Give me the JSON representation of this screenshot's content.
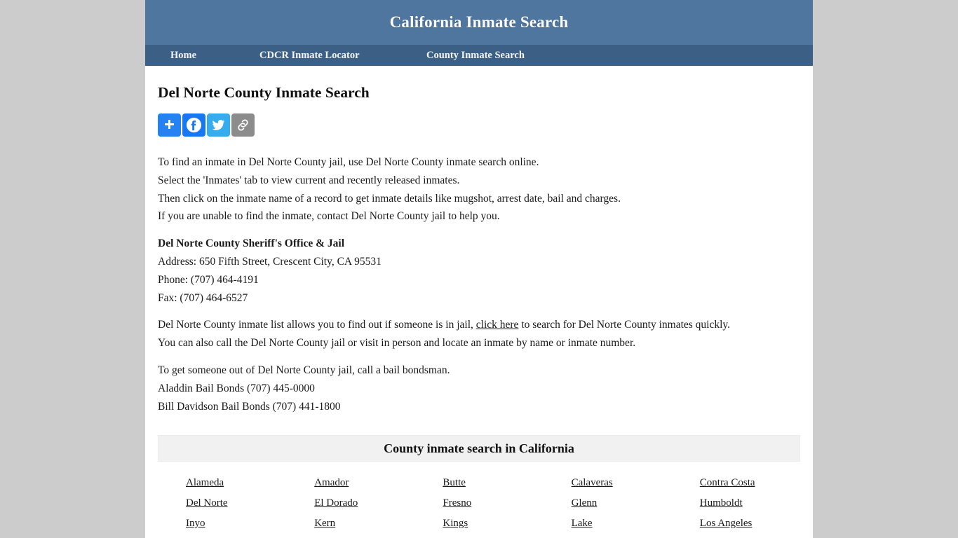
{
  "site": {
    "title": "California Inmate Search",
    "header_bg": "#4f769e",
    "nav_bg": "#3c6085",
    "page_bg": "#cccccc"
  },
  "nav": {
    "items": [
      {
        "label": "Home"
      },
      {
        "label": "CDCR Inmate Locator"
      },
      {
        "label": "County Inmate Search"
      }
    ]
  },
  "main": {
    "page_title": "Del Norte County Inmate Search",
    "share": {
      "buttons": [
        {
          "name": "addthis",
          "label": "Share",
          "color": "#2681f2"
        },
        {
          "name": "facebook",
          "label": "Facebook",
          "color": "#1877f2"
        },
        {
          "name": "twitter",
          "label": "Twitter",
          "color": "#35acee"
        },
        {
          "name": "copy-link",
          "label": "Copy Link",
          "color": "#8c8c8c"
        }
      ]
    },
    "intro_lines": [
      "To find an inmate in Del Norte County jail, use Del Norte County inmate search online.",
      "Select the 'Inmates' tab to view current and recently released inmates.",
      "Then click on the inmate name of a record to get inmate details like mugshot, arrest date, bail and charges.",
      "If you are unable to find the inmate, contact Del Norte County jail to help you."
    ],
    "facility": {
      "name": "Del Norte County Sheriff's Office & Jail",
      "address": "Address: 650 Fifth Street, Crescent City, CA 95531",
      "phone": "Phone: (707) 464-4191",
      "fax": "Fax: (707) 464-6527"
    },
    "list_paragraph": {
      "before_link": "Del Norte County inmate list allows you to find out if someone is in jail, ",
      "link_text": "click here",
      "after_link": " to search for Del Norte County inmates quickly.",
      "second_line": "You can also call the Del Norte County jail or visit in person and locate an inmate by name or inmate number."
    },
    "bail": {
      "intro": "To get someone out of Del Norte County jail, call a bail bondsman.",
      "bondsmen": [
        "Aladdin Bail Bonds (707) 445-0000",
        "Bill Davidson Bail Bonds (707) 441-1800"
      ]
    },
    "county_section": {
      "banner_title": "County inmate search in California",
      "counties": [
        "Alameda",
        "Amador",
        "Butte",
        "Calaveras",
        "Contra Costa",
        "Del Norte",
        "El Dorado",
        "Fresno",
        "Glenn",
        "Humboldt",
        "Inyo",
        "Kern",
        "Kings",
        "Lake",
        "Los Angeles"
      ]
    }
  }
}
